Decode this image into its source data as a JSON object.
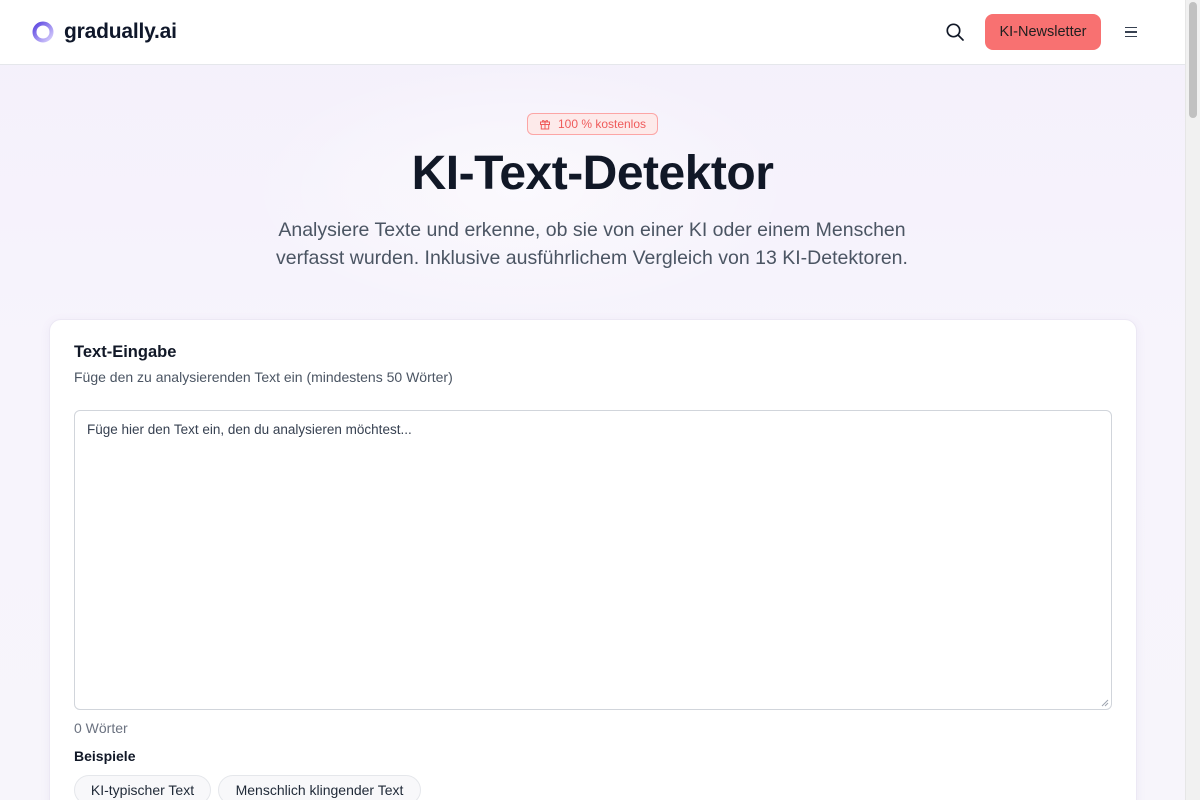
{
  "header": {
    "logo_text": "gradually.ai",
    "newsletter_label": "KI-Newsletter"
  },
  "hero": {
    "badge": "100 % kostenlos",
    "title": "KI-Text-Detektor",
    "subtitle": "Analysiere Texte und erkenne, ob sie von einer KI oder einem Menschen verfasst wurden. Inklusive ausführlichem Vergleich von 13 KI-Detektoren."
  },
  "card": {
    "title": "Text-Eingabe",
    "description": "Füge den zu analysierenden Text ein (mindestens 50 Wörter)",
    "textarea_placeholder": "Füge hier den Text ein, den du analysieren möchtest...",
    "textarea_value": "",
    "word_count": "0 Wörter",
    "examples_label": "Beispiele",
    "examples": [
      "KI-typischer Text",
      "Menschlich klingender Text"
    ]
  },
  "colors": {
    "accent": "#f87171",
    "logo_gradient": [
      "#6d5ce7",
      "#c4b5fd"
    ]
  },
  "icons": {
    "search": "search-icon",
    "menu": "hamburger-menu-icon",
    "badge": "gift-icon"
  }
}
